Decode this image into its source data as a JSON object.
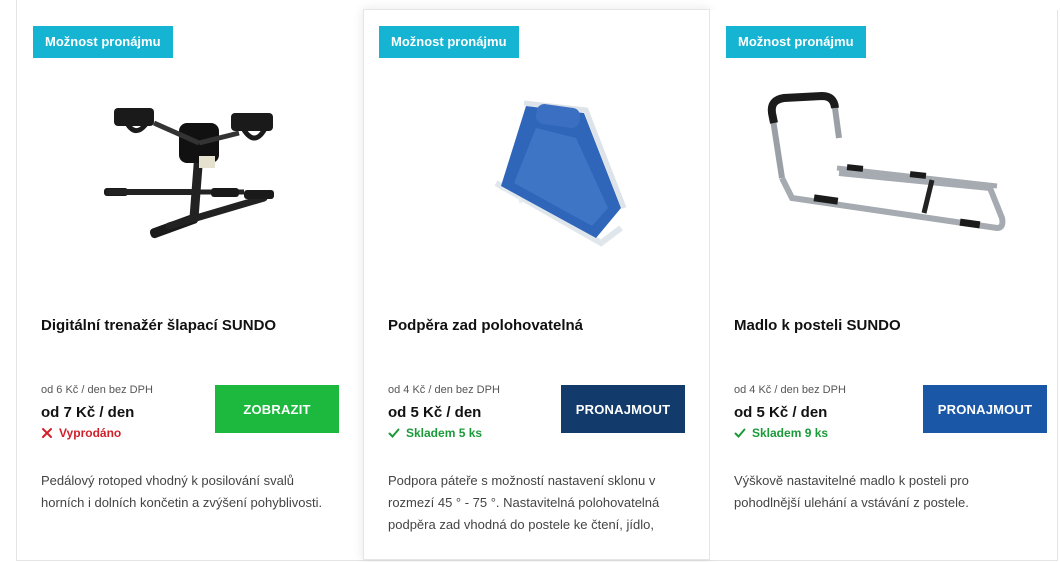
{
  "colors": {
    "badge": "#14b4d2",
    "show_button": "#1db93f",
    "rent_button_dark": "#123b6c",
    "rent_button": "#1a57a6",
    "sold_out": "#d0202a",
    "in_stock": "#1c9a3a"
  },
  "products": [
    {
      "badge": "Možnost pronájmu",
      "image_icon": "pedal-exerciser-image",
      "title": "Digitální trenažér šlapací SUNDO",
      "price_small": "od 6 Kč / den bez DPH",
      "price_main": "od 7 Kč / den",
      "stock_icon": "cross-icon",
      "stock": "Vyprodáno",
      "button": "ZOBRAZIT",
      "description": "Pedálový rotoped vhodný k posilování svalů horních i dolních končetin a zvýšení pohyblivosti."
    },
    {
      "badge": "Možnost pronájmu",
      "image_icon": "backrest-image",
      "title": "Podpěra zad polohovatelná",
      "price_small": "od 4 Kč / den bez DPH",
      "price_main": "od 5 Kč / den",
      "stock_icon": "check-icon",
      "stock": "Skladem 5 ks",
      "button": "PRONAJMOUT",
      "description": "Podpora páteře s možností nastavení sklonu v rozmezí 45 ° - 75 °. Nastavitelná polohovatelná podpěra zad vhodná do postele ke čtení, jídlo,"
    },
    {
      "badge": "Možnost pronájmu",
      "image_icon": "bed-rail-image",
      "title": "Madlo k posteli SUNDO",
      "price_small": "od 4 Kč / den bez DPH",
      "price_main": "od 5 Kč / den",
      "stock_icon": "check-icon",
      "stock": "Skladem 9 ks",
      "button": "PRONAJMOUT",
      "description": "Výškově nastavitelné madlo k posteli pro pohodlnější ulehání a vstávání z postele."
    }
  ]
}
